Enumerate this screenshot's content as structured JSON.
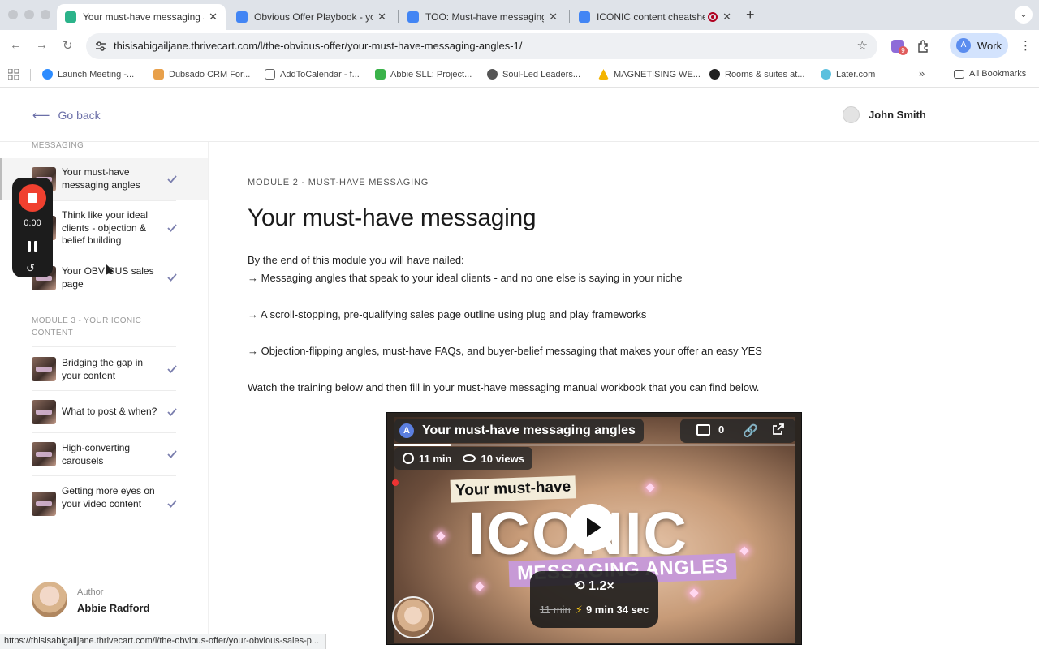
{
  "browser": {
    "tabs": [
      {
        "title": "Your must-have messaging a",
        "favicon_color": "#2bb38a",
        "active": true
      },
      {
        "title": "Obvious Offer Playbook - you",
        "favicon_color": "#4285f4",
        "active": false
      },
      {
        "title": "TOO: Must-have messaging n",
        "favicon_color": "#4285f4",
        "active": false
      },
      {
        "title": "ICONIC content cheatshe",
        "favicon_color": "#4285f4",
        "active": false
      }
    ],
    "new_tab_label": "+",
    "url": "thisisabigailjane.thrivecart.com/l/the-obvious-offer/your-must-have-messaging-angles-1/",
    "extension_badge": "9",
    "profile_label": "Work",
    "profile_initial": "A",
    "bookmarks": [
      {
        "label": "Launch Meeting -...",
        "color": "#2d8cff"
      },
      {
        "label": "Dubsado CRM For...",
        "color": "#e8a04a"
      },
      {
        "label": "AddToCalendar - f...",
        "color": "#666666"
      },
      {
        "label": "Abbie SLL: Project...",
        "color": "#3ab34a"
      },
      {
        "label": "Soul-Led Leaders...",
        "color": "#555555"
      },
      {
        "label": "MAGNETISING WE...",
        "color": "#f4b400"
      },
      {
        "label": "Rooms & suites at...",
        "color": "#222222"
      },
      {
        "label": "Later.com",
        "color": "#5bc0de"
      }
    ],
    "all_bookmarks_label": "All Bookmarks",
    "status_url": "https://thisisabigailjane.thrivecart.com/l/the-obvious-offer/your-obvious-sales-p..."
  },
  "header": {
    "go_back_label": "Go back",
    "user_name": "John Smith"
  },
  "sidebar": {
    "cutoff_section": "MESSAGING",
    "module2_lessons": [
      {
        "title": "Your must-have messaging angles",
        "active": true
      },
      {
        "title": "Think like your ideal clients - objection & belief building",
        "active": false
      },
      {
        "title": "Your OBVIOUS sales page",
        "active": false
      }
    ],
    "module3_label": "MODULE 3 - YOUR ICONIC CONTENT",
    "module3_lessons": [
      {
        "title": "Bridging the gap in your content"
      },
      {
        "title": "What to post & when?"
      },
      {
        "title": "High-converting carousels"
      },
      {
        "title": "Getting more eyes on your video content"
      }
    ],
    "author_label": "Author",
    "author_name": "Abbie Radford"
  },
  "recorder": {
    "time": "0:00"
  },
  "main": {
    "module_label": "MODULE 2 - MUST-HAVE MESSAGING",
    "title": "Your must-have messaging",
    "intro": "By the end of this module you will have nailed:",
    "bullet1": "→ Messaging angles that speak to your ideal clients - and no one else is saying in your niche",
    "bullet2": "→ A scroll-stopping, pre-qualifying sales page outline using plug and play frameworks",
    "bullet3": "→ Objection-flipping angles, must-have FAQs, and buyer-belief messaging that makes your offer an easy YES",
    "outro": "Watch the training below and then fill in your must-have messaging manual workbook that you can find below."
  },
  "video": {
    "initial": "A",
    "title": "Your must-have messaging angles",
    "comment_count": "0",
    "duration": "11 min",
    "views": "10 views",
    "progress": 0.14,
    "overlay_sub": "Your must-have",
    "overlay_big": "ICONIC",
    "overlay_band": "MESSAGING ANGLES",
    "speed": "1.2×",
    "old_time": "11 min",
    "new_time": "9 min 34 sec"
  }
}
